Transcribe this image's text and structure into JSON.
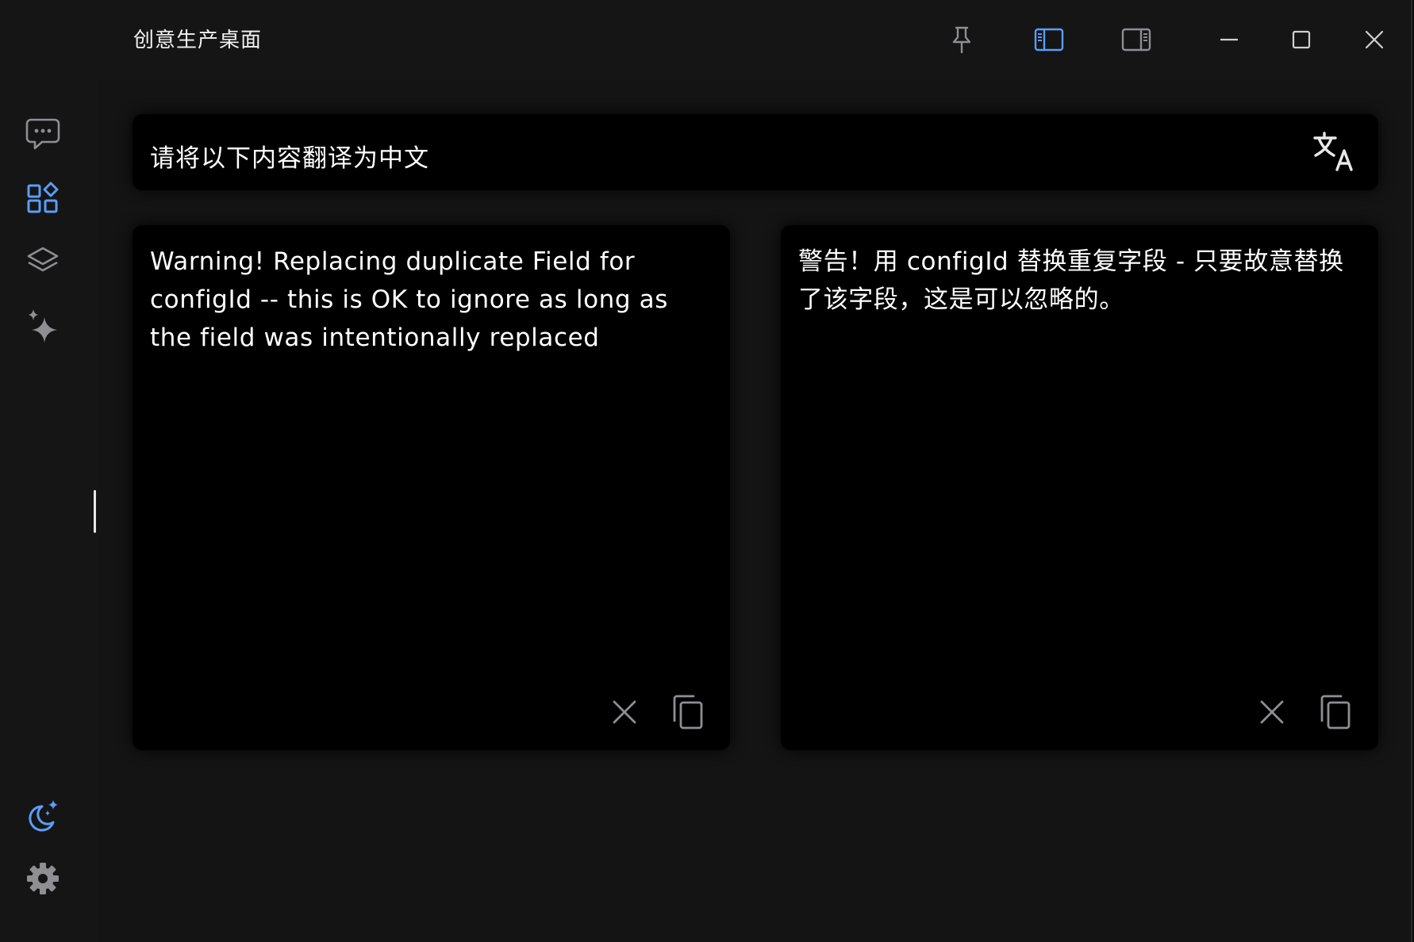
{
  "window": {
    "title": "创意生产桌面",
    "controls": [
      "pin-icon",
      "sidebar-left-icon",
      "sidebar-right-icon",
      "minimize-icon",
      "maximize-icon",
      "close-icon"
    ]
  },
  "sidebar": {
    "items": [
      {
        "icon": "chat-icon",
        "active": false
      },
      {
        "icon": "apps-icon",
        "active": true
      },
      {
        "icon": "layers-icon",
        "active": false
      },
      {
        "icon": "sparkle-icon",
        "active": false
      }
    ],
    "bottom": [
      {
        "icon": "night-mode-icon"
      },
      {
        "icon": "gear-icon"
      }
    ]
  },
  "prompt": {
    "text": "请将以下内容翻译为中文",
    "icon": "translate-icon"
  },
  "source_panel": {
    "text": "Warning! Replacing duplicate Field for configId -- this is OK to ignore as long as the field was intentionally replaced"
  },
  "target_panel": {
    "text": "警告！用 configId 替换重复字段 - 只要故意替换了该字段，这是可以忽略的。"
  },
  "colors": {
    "accent": "#5c9df6",
    "icon_gray": "#8e8e93",
    "panel_bg": "#000000",
    "window_bg": "#151516"
  }
}
